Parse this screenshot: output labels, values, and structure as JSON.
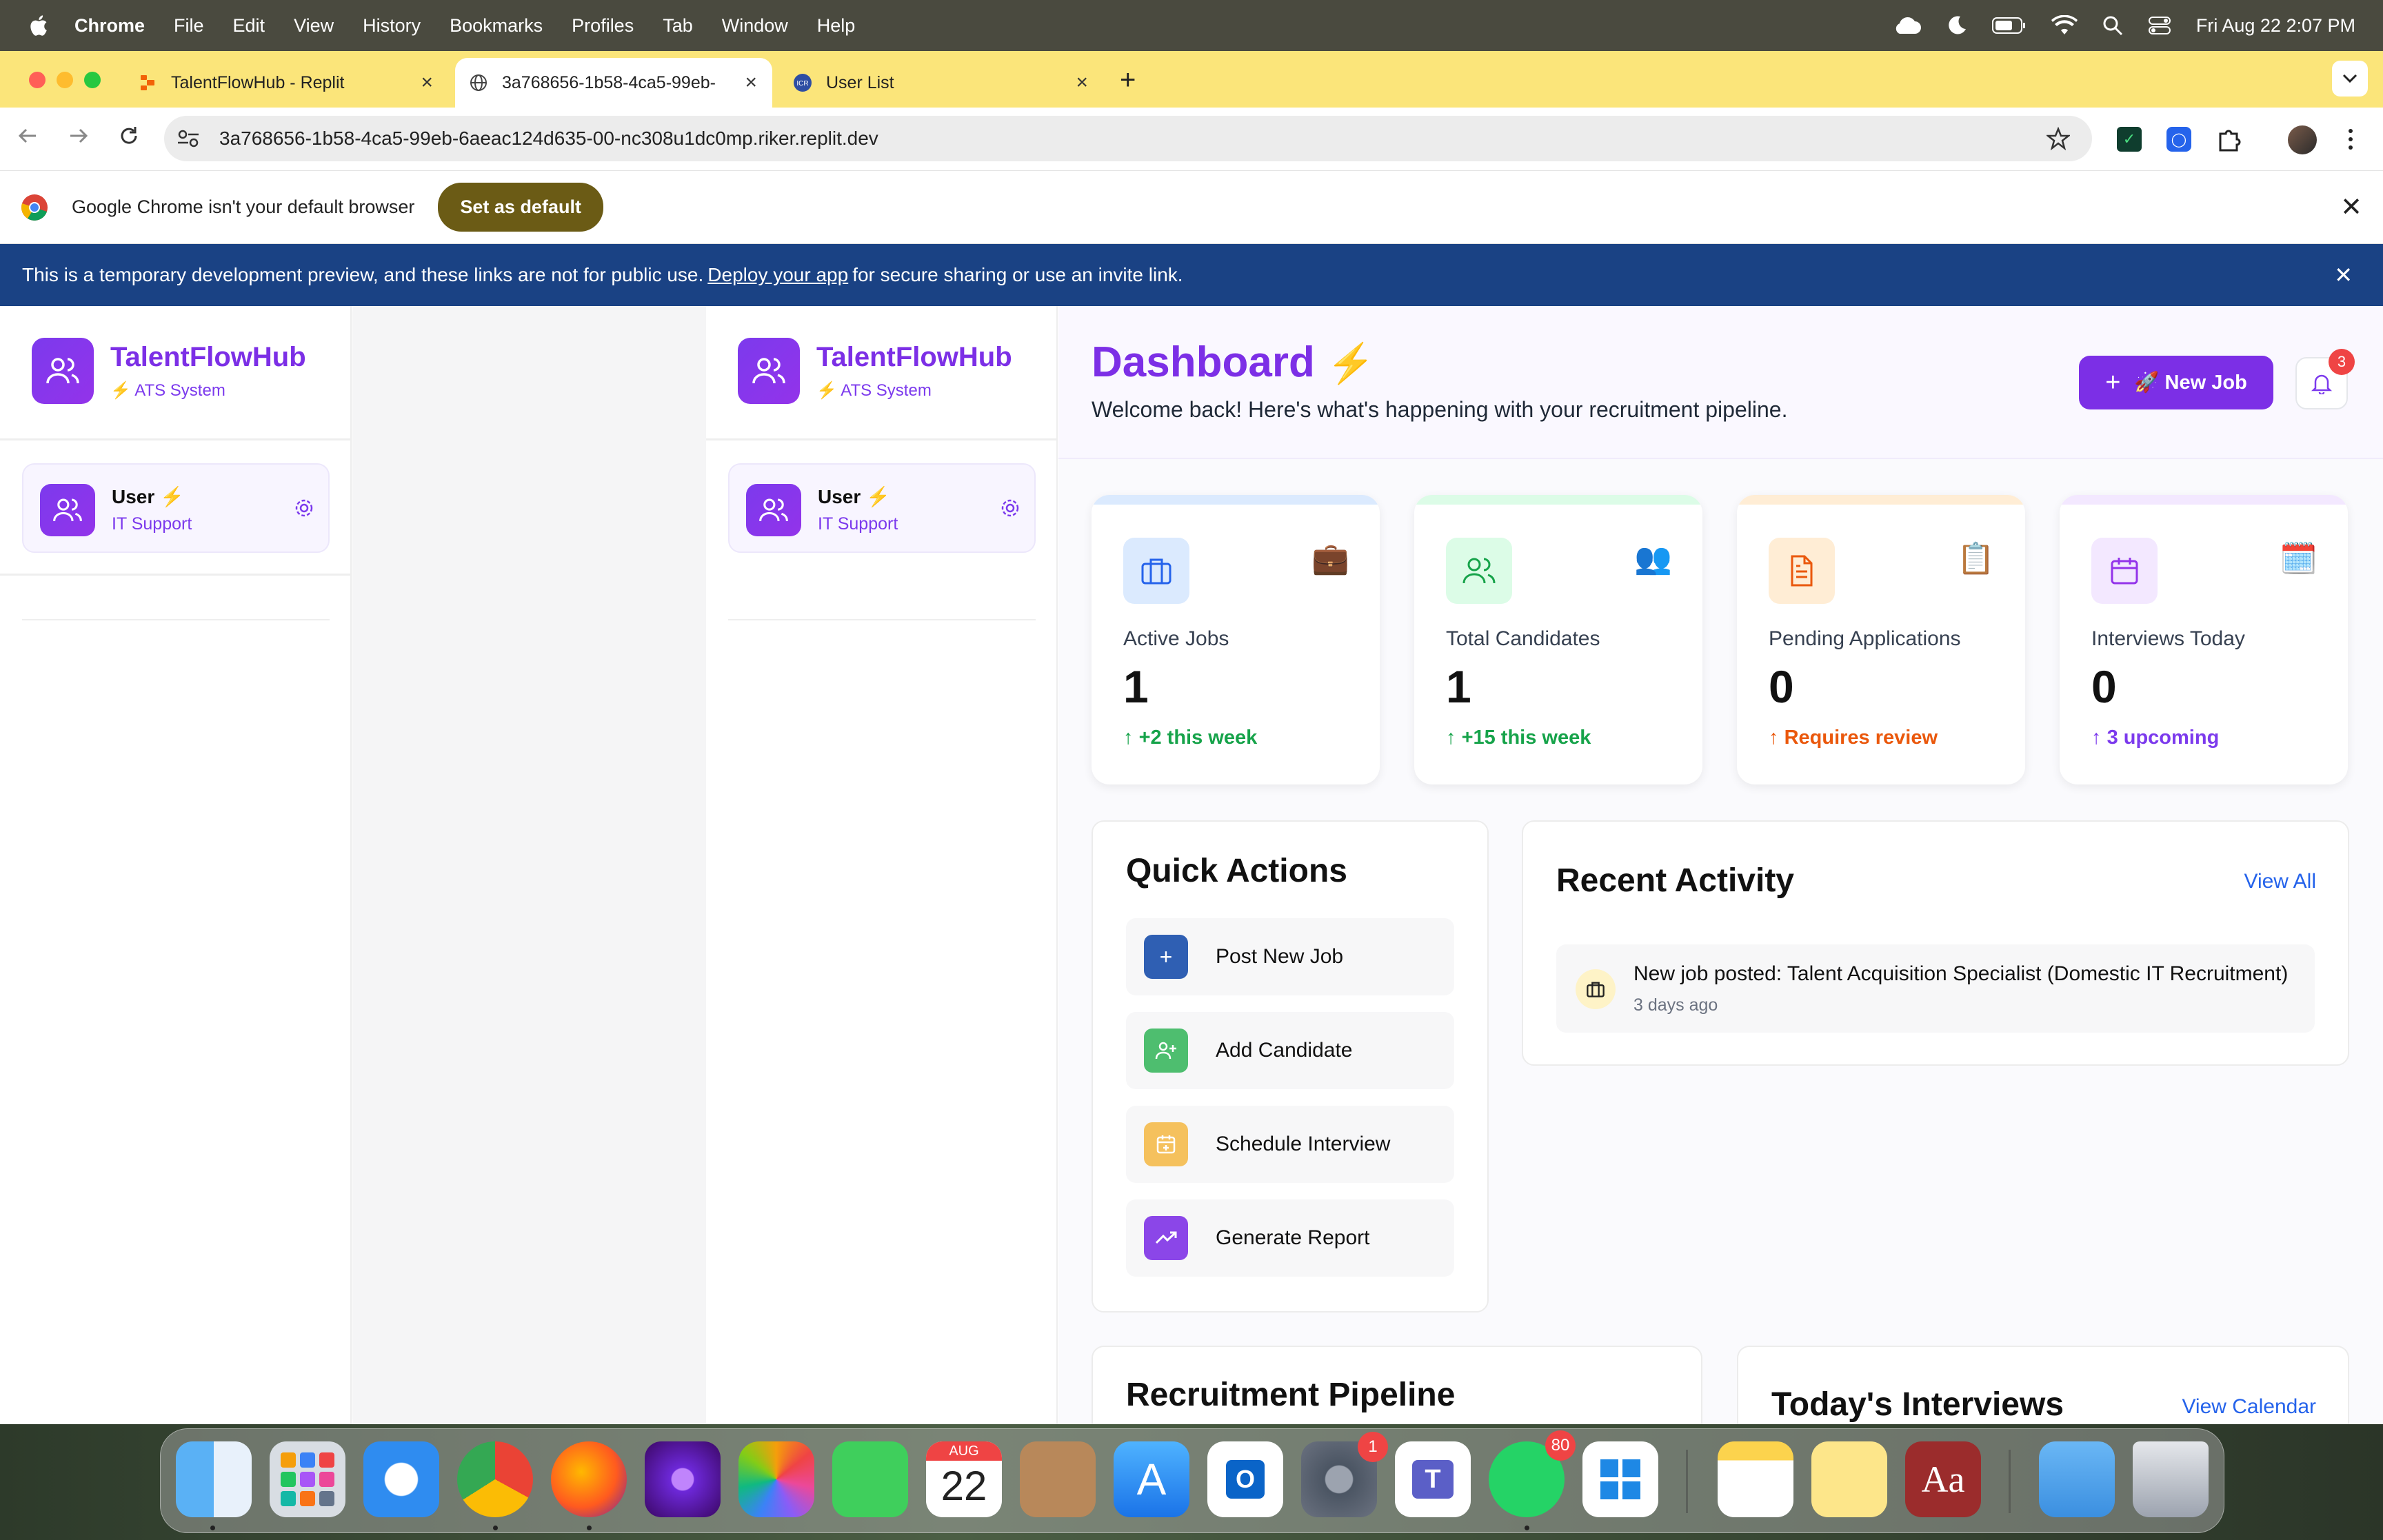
{
  "menubar": {
    "app": "Chrome",
    "items": [
      "File",
      "Edit",
      "View",
      "History",
      "Bookmarks",
      "Profiles",
      "Tab",
      "Window",
      "Help"
    ],
    "datetime": "Fri Aug 22  2:07 PM"
  },
  "tabs": [
    {
      "title": "TalentFlowHub - Replit"
    },
    {
      "title": "3a768656-1b58-4ca5-99eb-"
    },
    {
      "title": "User List"
    }
  ],
  "address": {
    "url": "3a768656-1b58-4ca5-99eb-6aeac124d635-00-nc308u1dc0mp.riker.replit.dev"
  },
  "infobar": {
    "message": "Google Chrome isn't your default browser",
    "button": "Set as default"
  },
  "devbanner": {
    "before": "This is a temporary development preview, and these links are not for public use.",
    "link": "Deploy your app",
    "after": "for secure sharing or use an invite link."
  },
  "sidebar": {
    "brand": "TalentFlowHub",
    "subtitle": "⚡ ATS System",
    "user_name": "User",
    "user_role": "IT Support"
  },
  "header": {
    "title": "Dashboard",
    "subtitle": "Welcome back! Here's what's happening with your recruitment pipeline.",
    "new_job": "🚀 New Job",
    "notif_count": "3"
  },
  "stats": [
    {
      "label": "Active Jobs",
      "value": "1",
      "trend": "+2 this week",
      "emoji": "💼",
      "color": "#16a34a"
    },
    {
      "label": "Total Candidates",
      "value": "1",
      "trend": "+15 this week",
      "emoji": "👥",
      "color": "#16a34a"
    },
    {
      "label": "Pending Applications",
      "value": "0",
      "trend": "Requires review",
      "emoji": "📋",
      "color": "#ea580c"
    },
    {
      "label": "Interviews Today",
      "value": "0",
      "trend": "3 upcoming",
      "emoji": "🗓️",
      "color": "#7c3aed"
    }
  ],
  "quick_actions": {
    "title": "Quick Actions",
    "items": [
      "Post New Job",
      "Add Candidate",
      "Schedule Interview",
      "Generate Report"
    ]
  },
  "recent_activity": {
    "title": "Recent Activity",
    "view_all": "View All",
    "items": [
      {
        "text": "New job posted: Talent Acquisition Specialist (Domestic IT Recruitment)",
        "time": "3 days ago"
      }
    ]
  },
  "pipeline": {
    "title": "Recruitment Pipeline"
  },
  "interviews": {
    "title": "Today's Interviews",
    "view_calendar": "View Calendar"
  },
  "dock": {
    "calendar_month": "AUG",
    "calendar_day": "22",
    "settings_badge": "1",
    "whatsapp_badge": "80",
    "dictionary_label": "Aa"
  }
}
